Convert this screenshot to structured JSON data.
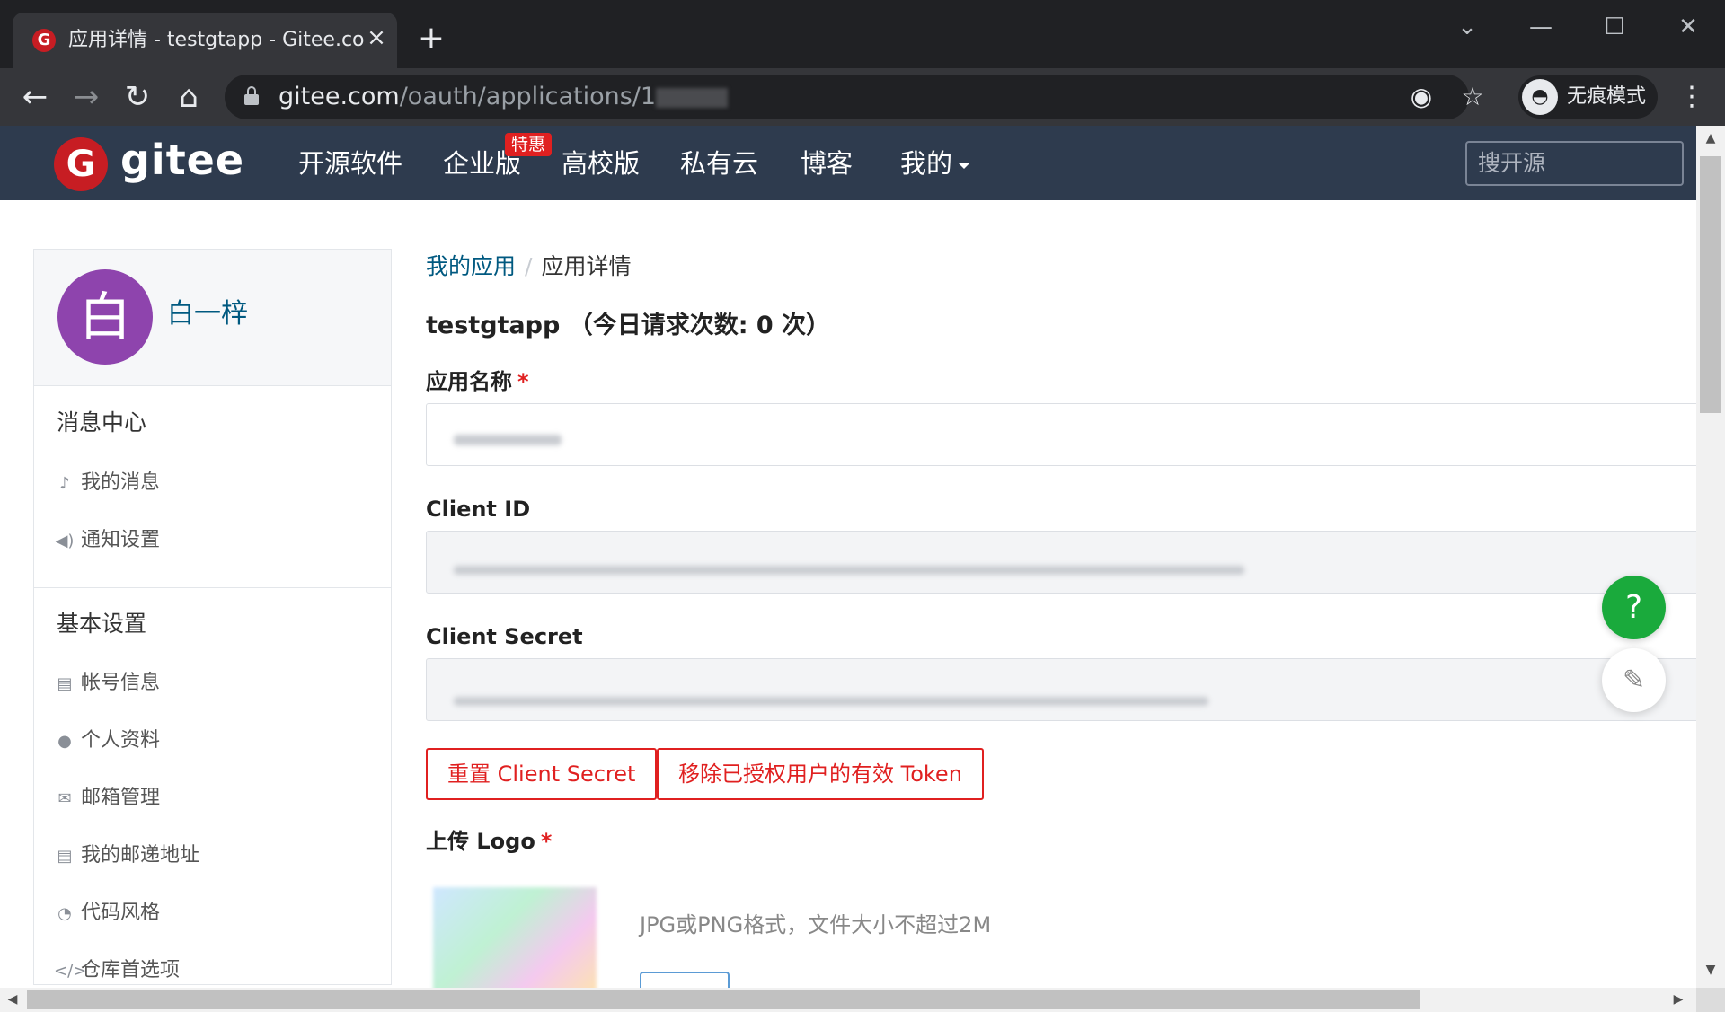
{
  "browser": {
    "tab_title": "应用详情 - testgtapp - Gitee.com",
    "new_tab": "+",
    "url_host": "gitee.com",
    "url_path": "/oauth/applications/1",
    "incognito_label": "无痕模式"
  },
  "header": {
    "logo_text": "gitee",
    "nav": [
      "开源软件",
      "企业版",
      "高校版",
      "私有云",
      "博客",
      "我的"
    ],
    "badge": "特惠",
    "search_placeholder": "搜开源"
  },
  "sidebar": {
    "avatar_char": "白",
    "username": "白一梓",
    "section1_title": "消息中心",
    "section1_items": [
      {
        "label": "我的消息",
        "icon": "bell-icon"
      },
      {
        "label": "通知设置",
        "icon": "speaker-icon"
      }
    ],
    "section2_title": "基本设置",
    "section2_items": [
      {
        "label": "帐号信息",
        "icon": "id-card-icon"
      },
      {
        "label": "个人资料",
        "icon": "user-icon"
      },
      {
        "label": "邮箱管理",
        "icon": "envelope-icon"
      },
      {
        "label": "我的邮递地址",
        "icon": "address-card-icon"
      },
      {
        "label": "代码风格",
        "icon": "dashboard-icon"
      },
      {
        "label": "仓库首选项",
        "icon": "code-icon"
      }
    ]
  },
  "main": {
    "breadcrumb_link": "我的应用",
    "breadcrumb_sep": "/",
    "breadcrumb_current": "应用详情",
    "app_title": "testgtapp （今日请求次数: 0 次）",
    "field_name_label": "应用名称",
    "required_mark": "*",
    "client_id_label": "Client ID",
    "client_secret_label": "Client Secret",
    "btn_reset_secret": "重置 Client Secret",
    "btn_revoke_tokens": "移除已授权用户的有效 Token",
    "upload_logo_label": "上传 Logo",
    "upload_hint": "JPG或PNG格式，文件大小不超过2M"
  },
  "floating": {
    "help": "?"
  },
  "colors": {
    "header_bg": "#2e3b4e",
    "brand_red": "#c71d23",
    "danger": "#e02020",
    "link": "#005980",
    "help_green": "#1aaa3c",
    "avatar_purple": "#8e44ad"
  }
}
